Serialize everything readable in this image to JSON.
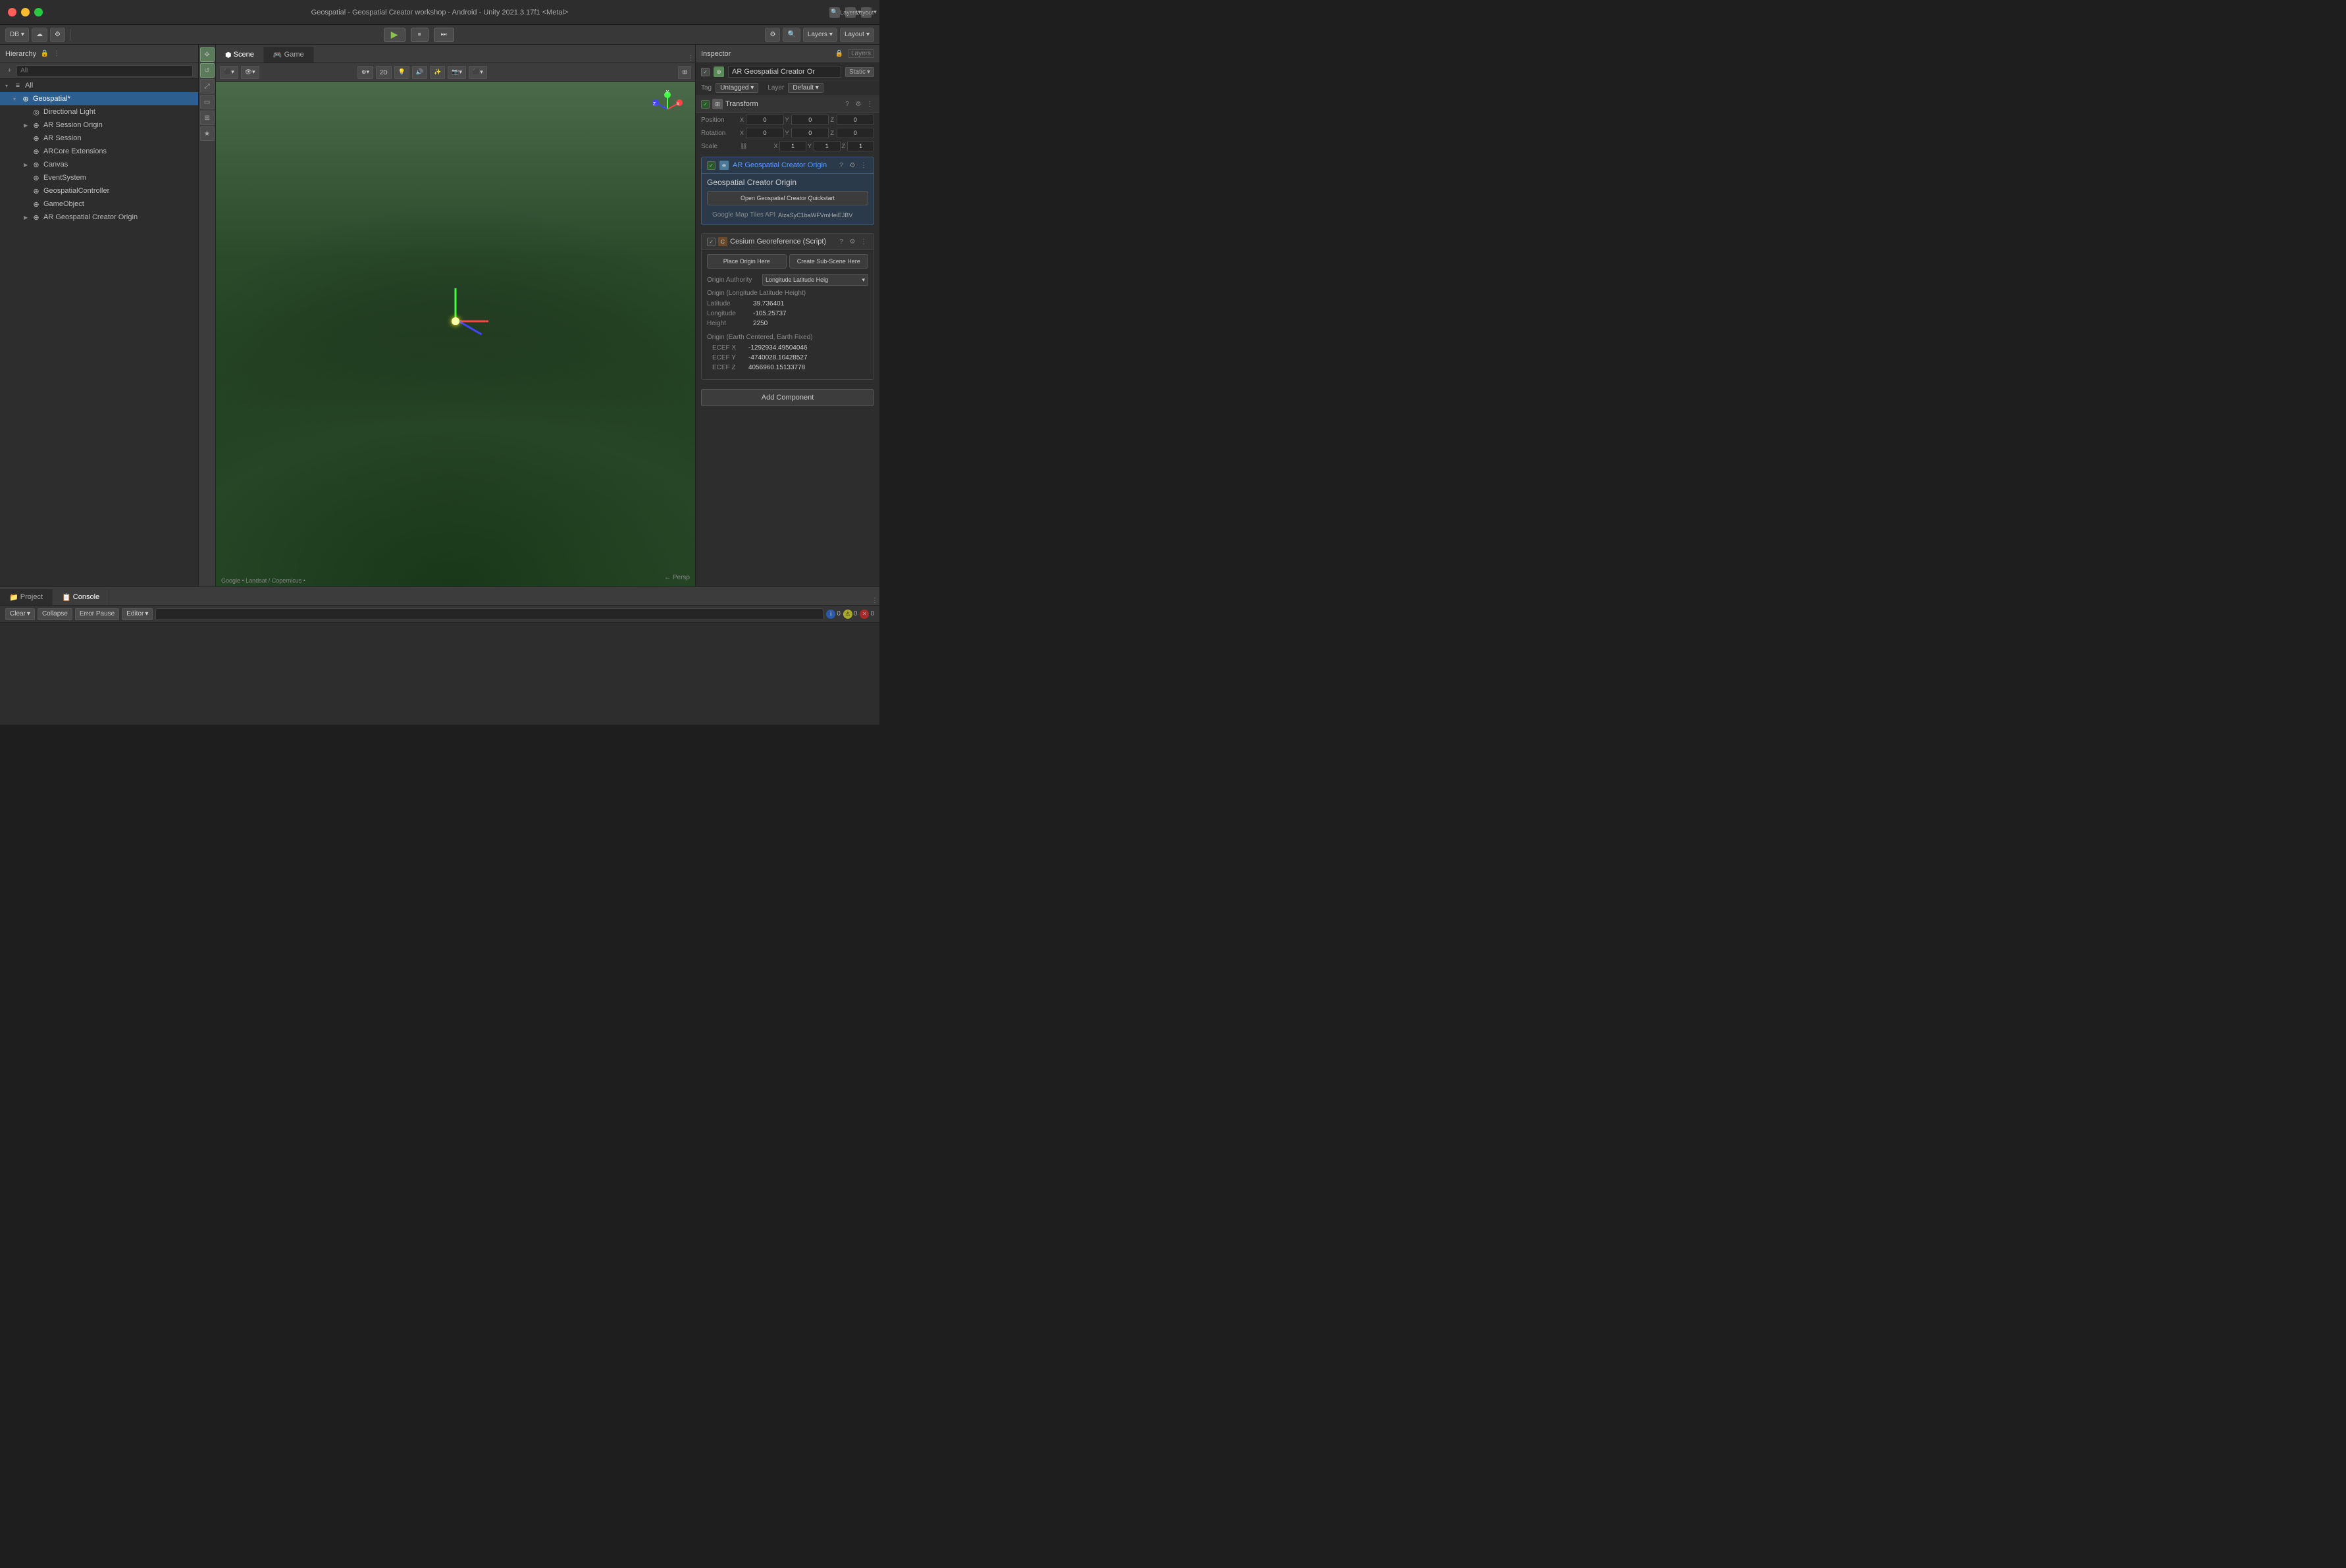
{
  "window": {
    "title": "Geospatial - Geospatial Creator workshop - Android - Unity 2021.3.17f1 <Metal>",
    "controls": {
      "close": "●",
      "min": "●",
      "max": "●"
    }
  },
  "toolbar": {
    "db_label": "DB",
    "layout_label": "Layout",
    "layers_label": "Layers",
    "play": "▶",
    "pause": "⏸",
    "step": "⏭"
  },
  "hierarchy": {
    "title": "Hierarchy",
    "search_placeholder": "All",
    "items": [
      {
        "indent": 0,
        "name": "All",
        "arrow": "▾",
        "icon": "≡"
      },
      {
        "indent": 1,
        "name": "Geospatial*",
        "arrow": "▾",
        "icon": "⊕",
        "selected": true
      },
      {
        "indent": 2,
        "name": "Directional Light",
        "arrow": "",
        "icon": "◎"
      },
      {
        "indent": 2,
        "name": "AR Session Origin",
        "arrow": "▶",
        "icon": "⊕"
      },
      {
        "indent": 2,
        "name": "AR Session",
        "arrow": "",
        "icon": "⊕"
      },
      {
        "indent": 2,
        "name": "ARCore Extensions",
        "arrow": "",
        "icon": "⊕"
      },
      {
        "indent": 2,
        "name": "Canvas",
        "arrow": "▶",
        "icon": "⊕"
      },
      {
        "indent": 2,
        "name": "EventSystem",
        "arrow": "",
        "icon": "⊕"
      },
      {
        "indent": 2,
        "name": "GeospatialController",
        "arrow": "",
        "icon": "⊕"
      },
      {
        "indent": 2,
        "name": "GameObject",
        "arrow": "",
        "icon": "⊕"
      },
      {
        "indent": 2,
        "name": "AR Geospatial Creator Origin",
        "arrow": "▶",
        "icon": "⊕"
      }
    ]
  },
  "viewport": {
    "scene_tab": "Scene",
    "game_tab": "Game",
    "mode_2d": "2D",
    "persp_label": "← Persp",
    "attribution": "Google • Landsat / Copernicus •"
  },
  "inspector": {
    "title": "Inspector",
    "layers_tab": "Layers",
    "object_name": "AR Geospatial Creator Or",
    "static_label": "Static",
    "tag_label": "Tag",
    "tag_value": "Untagged",
    "layer_label": "Layer",
    "layer_value": "Default",
    "transform": {
      "title": "Transform",
      "position_label": "Position",
      "rotation_label": "Rotation",
      "scale_label": "Scale",
      "pos_x": "0",
      "pos_y": "0",
      "pos_z": "0",
      "rot_x": "0",
      "rot_y": "0",
      "rot_z": "0",
      "scale_lock": "🔗",
      "scale_x": "1",
      "scale_y": "1",
      "scale_z": "1"
    },
    "geospatial_origin": {
      "title": "AR Geospatial Creator Origin",
      "component_title": "Geospatial Creator Origin",
      "open_quickstart_btn": "Open Geospatial Creator Quickstart",
      "api_key_label": "Google Map Tiles API",
      "api_key_value": "AlzaSyC1baWFVmHeiEJBV"
    },
    "cesium": {
      "title": "Cesium Georeference (Script)",
      "place_origin_btn": "Place Origin Here",
      "create_sub_scene_btn": "Create Sub-Scene Here",
      "origin_authority_label": "Origin Authority",
      "origin_authority_value": "Longitude Latitude Heig",
      "origin_section_title": "Origin (Longitude Latitude Height)",
      "latitude_label": "Latitude",
      "latitude_value": "39.736401",
      "longitude_label": "Longitude",
      "longitude_value": "-105.25737",
      "height_label": "Height",
      "height_value": "2250",
      "ecef_section_title": "Origin (Earth Centered, Earth Fixed)",
      "ecef_x_label": "ECEF X",
      "ecef_x_value": "-1292934.49504046",
      "ecef_y_label": "ECEF Y",
      "ecef_y_value": "-4740028.10428527",
      "ecef_z_label": "ECEF Z",
      "ecef_z_value": "4056960.15133778"
    },
    "add_component_btn": "Add Component"
  },
  "bottom": {
    "project_tab": "Project",
    "console_tab": "Console",
    "clear_btn": "Clear",
    "collapse_btn": "Collapse",
    "error_pause_btn": "Error Pause",
    "editor_btn": "Editor",
    "search_placeholder": "",
    "info_count": "0",
    "warn_count": "0",
    "error_count": "0"
  },
  "icons": {
    "arrow_right": "▶",
    "arrow_down": "▾",
    "settings": "⚙",
    "lock": "🔒",
    "search": "🔍",
    "plus": "+",
    "three_dots": "⋮",
    "checkbox_checked": "✓",
    "dropdown_arrow": "▾",
    "chain": "⛓",
    "question": "?",
    "gear": "⚙",
    "move": "✥",
    "rotate": "↺",
    "scale": "⤢",
    "rect": "▭",
    "transform_all": "⊞",
    "custom": "★"
  }
}
